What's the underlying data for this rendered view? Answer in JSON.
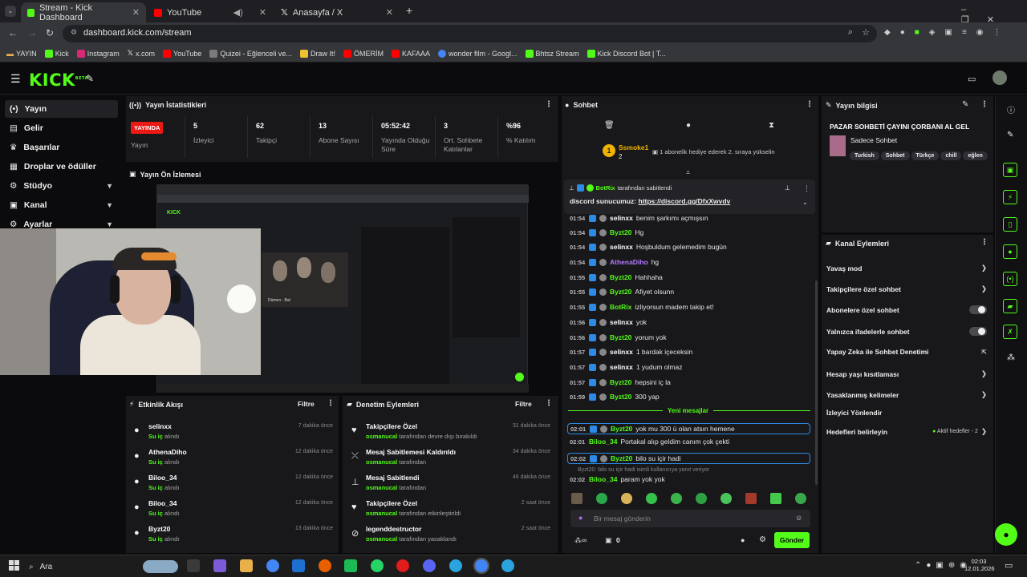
{
  "browser": {
    "tabs": [
      {
        "label": "Stream - Kick Dashboard",
        "active": true
      },
      {
        "label": "YouTube",
        "active": false
      },
      {
        "label": "Anasayfa / X",
        "active": false
      }
    ],
    "url": "dashboard.kick.com/stream",
    "bookmarks": [
      "YAYIN",
      "Kick",
      "Instagram",
      "x.com",
      "YouTube",
      "Quizei - Eğlenceli ve...",
      "Draw It!",
      "ÖMERİM",
      "KAFAAA",
      "wonder film - Googl...",
      "Bhtsz Stream",
      "Kick Discord Bot | T..."
    ]
  },
  "header": {
    "logo": "KICK",
    "logo_sup": "BETA"
  },
  "sidebar": {
    "items": [
      {
        "label": "Yayın",
        "icon": "broadcast-icon",
        "active": true
      },
      {
        "label": "Gelir",
        "icon": "revenue-icon"
      },
      {
        "label": "Başarılar",
        "icon": "trophy-icon"
      },
      {
        "label": "Droplar ve ödüller",
        "icon": "gift-icon"
      },
      {
        "label": "Stüdyo",
        "icon": "studio-icon",
        "chevron": true
      },
      {
        "label": "Kanal",
        "icon": "channel-icon",
        "chevron": true
      },
      {
        "label": "Ayarlar",
        "icon": "settings-icon",
        "chevron": true
      }
    ]
  },
  "stats": {
    "title": "Yayın İstatistikleri",
    "live_badge": "YAYINDA",
    "live_label": "Yayın",
    "items": [
      {
        "value": "5",
        "label": "İzleyici"
      },
      {
        "value": "62",
        "label": "Takipçi"
      },
      {
        "value": "13",
        "label": "Abone Sayısı"
      },
      {
        "value": "05:52:42",
        "label": "Yayında Olduğu Süre"
      },
      {
        "value": "3",
        "label": "Ort. Sohbete Katılanlar"
      },
      {
        "value": "%96",
        "label": "% Katılım"
      }
    ]
  },
  "preview": {
    "title": "Yayın Ön İzlemesi",
    "caption": "Dümen - Bal"
  },
  "activity": {
    "title": "Etkinlik Akışı",
    "filter": "Filtre",
    "items": [
      {
        "user": "selinxx",
        "action": "Su iç",
        "suffix": "alındı",
        "time": "7 dakika önce"
      },
      {
        "user": "AthenaDiho",
        "action": "Su iç",
        "suffix": "alındı",
        "time": "12 dakika önce"
      },
      {
        "user": "Biloo_34",
        "action": "Su iç",
        "suffix": "alındı",
        "time": "12 dakika önce"
      },
      {
        "user": "Biloo_34",
        "action": "Su iç",
        "suffix": "alındı",
        "time": "12 dakika önce"
      },
      {
        "user": "Byzt20",
        "action": "Su iç",
        "suffix": "alındı",
        "time": "13 dakika önce"
      }
    ]
  },
  "moderation": {
    "title": "Denetim Eylemleri",
    "filter": "Filtre",
    "items": [
      {
        "title": "Takipçilere Özel",
        "actor": "osmanucal",
        "detail": "tarafından devre dışı bırakıldı",
        "time": "31 dakika önce",
        "icon": "heart-icon"
      },
      {
        "title": "Mesaj Sabitlemesi Kaldırıldı",
        "actor": "osmanucal",
        "detail": "tarafından",
        "time": "34 dakika önce",
        "icon": "unpin-icon"
      },
      {
        "title": "Mesaj Sabitlendi",
        "actor": "osmanucal",
        "detail": "tarafından",
        "time": "46 dakika önce",
        "icon": "pin-icon"
      },
      {
        "title": "Takipçilere Özel",
        "actor": "osmanucal",
        "detail": "tarafından etkinleştirildi",
        "time": "2 saat önce",
        "icon": "heart-icon"
      },
      {
        "title": "legenddestructor",
        "actor": "osmanucal",
        "detail": "tarafından yasaklandı",
        "time": "2 saat önce",
        "icon": "ban-icon"
      }
    ]
  },
  "chat": {
    "title": "Sohbet",
    "gift": {
      "user": "Ssmoke1",
      "count": "2",
      "text": "1 abonelik hediye ederek 2. sıraya yükselin"
    },
    "pinned": {
      "by": "BotRix",
      "by_suffix": "tarafından sabitlendi",
      "text": "discord sunucumuz:",
      "link": "https://discord.gg/DfxXwvdv"
    },
    "messages": [
      {
        "time": "01:54",
        "user": "selinxx",
        "color": "#ffffff",
        "text": "benim şarkımı açmışsın"
      },
      {
        "time": "01:54",
        "user": "Byzt20",
        "color": "#53fc18",
        "text": "Hg"
      },
      {
        "time": "01:54",
        "user": "selinxx",
        "color": "#ffffff",
        "text": "Hoşbuldum gelemedim bugün"
      },
      {
        "time": "01:54",
        "user": "AthenaDiho",
        "color": "#b57bff",
        "text": "hg"
      },
      {
        "time": "01:55",
        "user": "Byzt20",
        "color": "#53fc18",
        "text": "Hahhaha"
      },
      {
        "time": "01:55",
        "user": "Byzt20",
        "color": "#53fc18",
        "text": "Afiyet olsunn"
      },
      {
        "time": "01:55",
        "user": "BotRix",
        "color": "#53fc18",
        "text": "izliyorsun madem takip et!"
      },
      {
        "time": "01:56",
        "user": "selinxx",
        "color": "#ffffff",
        "text": "yok"
      },
      {
        "time": "01:56",
        "user": "Byzt20",
        "color": "#53fc18",
        "text": "yorum yok"
      },
      {
        "time": "01:57",
        "user": "selinxx",
        "color": "#ffffff",
        "text": "1 bardak içeceksin"
      },
      {
        "time": "01:57",
        "user": "selinxx",
        "color": "#ffffff",
        "text": "1 yudum olmaz"
      },
      {
        "time": "01:57",
        "user": "Byzt20",
        "color": "#53fc18",
        "text": "hepsini iç la"
      },
      {
        "time": "01:59",
        "user": "Byzt20",
        "color": "#53fc18",
        "text": "300 yap"
      }
    ],
    "new_label": "Yeni mesajlar",
    "new_messages": [
      {
        "time": "02:01",
        "user": "Byzt20",
        "color": "#53fc18",
        "text": "yok mu 300 ü olan atsın hemene",
        "boxed": true
      },
      {
        "time": "02:01",
        "user": "Biloo_34",
        "color": "#53fc18",
        "text": "Portakal alıp geldim canım çok çekti",
        "boxed": false
      },
      {
        "time": "02:02",
        "user": "Byzt20",
        "color": "#53fc18",
        "text": "bilo su içir hadi",
        "boxed": true
      },
      {
        "time": "02:02",
        "user": "Biloo_34",
        "color": "#53fc18",
        "text": "param yok yok",
        "boxed": false
      }
    ],
    "reply_hint": "Byzt20: bilo su içir hadi isimli kullanıcıya yanıt veriyor",
    "input_placeholder": "Bir mesaj gönderin",
    "footer_count": "0",
    "send_label": "Gönder"
  },
  "info": {
    "title": "Yayın bilgisi",
    "stream_title": "PAZAR SOHBETİ ÇAYINI ÇORBANI AL GEL",
    "category": "Sadece Sohbet",
    "tags": [
      "Turkish",
      "Sohbet",
      "Türkçe",
      "chill",
      "eğlen"
    ]
  },
  "actions": {
    "title": "Kanal Eylemleri",
    "items": [
      {
        "label": "Yavaş mod",
        "kind": "arrow"
      },
      {
        "label": "Takipçilere özel sohbet",
        "kind": "arrow"
      },
      {
        "label": "Abonelere özel sohbet",
        "kind": "toggle"
      },
      {
        "label": "Yalnızca ifadelerle sohbet",
        "kind": "toggle"
      },
      {
        "label": "Yapay Zeka ile Sohbet Denetimi",
        "kind": "external"
      },
      {
        "label": "Hesap yaşı kısıtlaması",
        "kind": "arrow"
      },
      {
        "label": "Yasaklanmış kelimeler",
        "kind": "arrow"
      },
      {
        "label": "İzleyici Yönlendir",
        "kind": "none"
      },
      {
        "label": "Hedefleri belirleyin",
        "kind": "arrow",
        "extra": "Aktif hedefler - 2"
      }
    ]
  },
  "taskbar": {
    "search": "Ara",
    "time": "02:03",
    "date": "12.01.2026"
  },
  "colors": {
    "accent": "#53fc18",
    "live": "#e91916",
    "panel": "#18181b",
    "bg": "#0b0b0d"
  }
}
